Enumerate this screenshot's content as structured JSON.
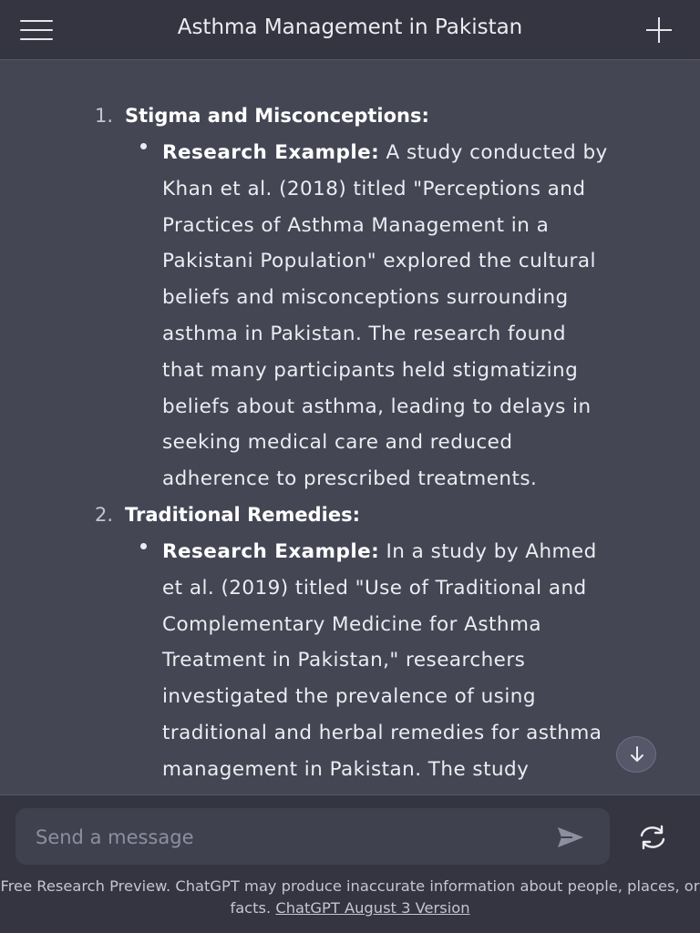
{
  "header": {
    "title": "Asthma Management in Pakistan",
    "menu_icon": "hamburger-menu-icon",
    "new_chat_icon": "plus-icon"
  },
  "conversation": {
    "items": [
      {
        "number": "1.",
        "heading": "Stigma and Misconceptions:",
        "bullet_label": "Research Example:",
        "lines": [
          " A study conducted by",
          "Khan et al. (2018) titled \"Perceptions and",
          "Practices of Asthma Management in a",
          "Pakistani Population\" explored the cultural",
          "beliefs and misconceptions surrounding",
          "asthma in Pakistan. The research found",
          "that many participants held stigmatizing",
          "beliefs about asthma, leading to delays in",
          "seeking medical care and reduced",
          "adherence to prescribed treatments."
        ]
      },
      {
        "number": "2.",
        "heading": "Traditional Remedies:",
        "bullet_label": "Research Example:",
        "lines": [
          " In a study by Ahmed",
          "et al. (2019) titled \"Use of Traditional and",
          "Complementary Medicine for Asthma",
          "Treatment in Pakistan,\" researchers",
          "investigated the prevalence of using",
          "traditional and herbal remedies for asthma",
          "management in Pakistan. The study"
        ]
      }
    ]
  },
  "scroll_down_icon": "arrow-down-icon",
  "composer": {
    "placeholder": "Send a message",
    "send_icon": "send-icon",
    "regenerate_icon": "regenerate-icon"
  },
  "footer": {
    "text": "Free Research Preview. ChatGPT may produce inaccurate information about people, places, or facts. ",
    "link": "ChatGPT August 3 Version"
  },
  "colors": {
    "header_bg": "#343541",
    "chat_bg": "#444654",
    "composer_bg": "#40414f",
    "text": "#ececf1"
  }
}
